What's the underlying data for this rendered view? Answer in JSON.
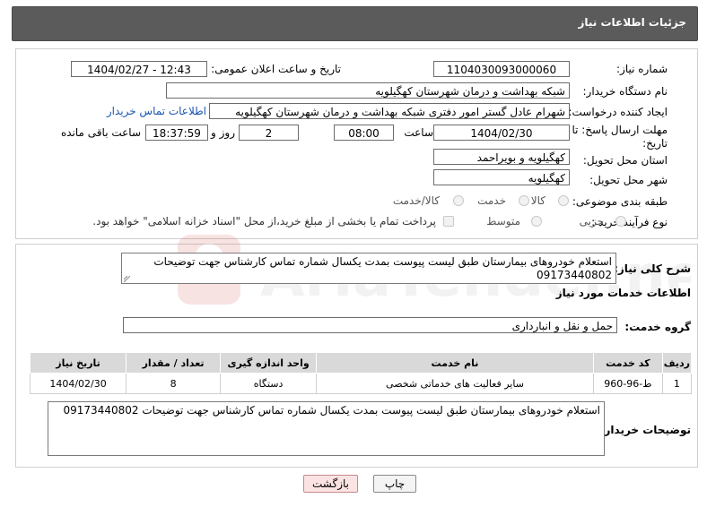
{
  "header": {
    "title": "جزئیات اطلاعات نیاز"
  },
  "form": {
    "need_number_label": "شماره نیاز:",
    "need_number": "1104030093000060",
    "announce_label": "تاریخ و ساعت اعلان عمومی:",
    "announce_value": "1404/02/27 - 12:43",
    "buyer_label": "نام دستگاه خریدار:",
    "buyer_value": "شبکه بهداشت و درمان شهرستان کهگیلویه",
    "creator_label": "ایجاد کننده درخواست:",
    "creator_value": "شهرام عادل گستر امور دفتری شبکه بهداشت و درمان شهرستان کهگیلویه",
    "contact_link": "اطلاعات تماس خریدار",
    "deadline_label_1": "مهلت ارسال پاسخ: تا",
    "deadline_label_2": "تاریخ:",
    "deadline_date": "1404/02/30",
    "time_label": "ساعت",
    "deadline_time": "08:00",
    "days_value": "2",
    "days_label": "روز و",
    "remaining_time": "18:37:59",
    "remaining_label": "ساعت باقی مانده",
    "province_label": "استان محل تحویل:",
    "province_value": "کهگیلویه و بویراحمد",
    "city_label": "شهر محل تحویل:",
    "city_value": "کهگیلویه",
    "category_label": "طبقه بندی موضوعی:",
    "category_options": [
      "کالا",
      "خدمت",
      "کالا/خدمت"
    ],
    "process_label": "نوع فرآیند خرید :",
    "process_options": [
      "جزیی",
      "متوسط"
    ],
    "payment_note": "پرداخت تمام یا بخشی از مبلغ خرید،از محل \"اسناد خزانه اسلامی\" خواهد بود."
  },
  "description": {
    "label": "شرح کلی نیاز:",
    "text": "استعلام خودروهای بیمارستان طبق لیست پیوست بمدت یکسال شماره تماس کارشناس جهت توضیحات 09173440802"
  },
  "services": {
    "section_title": "اطلاعات خدمات مورد نیاز",
    "group_label": "گروه خدمت:",
    "group_value": "حمل و نقل و انبارداری",
    "columns": [
      "ردیف",
      "کد خدمت",
      "نام خدمت",
      "واحد اندازه گیری",
      "تعداد / مقدار",
      "تاریخ نیاز"
    ],
    "rows": [
      [
        "1",
        "ط-96-960",
        "سایر فعالیت های خدماتی شخصی",
        "دستگاه",
        "8",
        "1404/02/30"
      ]
    ]
  },
  "buyer_notes": {
    "label": "توضیحات خریدار:",
    "text": "استعلام خودروهای بیمارستان طبق لیست پیوست بمدت یکسال شماره تماس کارشناس جهت توضیحات 09173440802"
  },
  "buttons": {
    "print": "چاپ",
    "back": "بازگشت"
  },
  "watermark": {
    "text": "AriaTender.neT"
  }
}
